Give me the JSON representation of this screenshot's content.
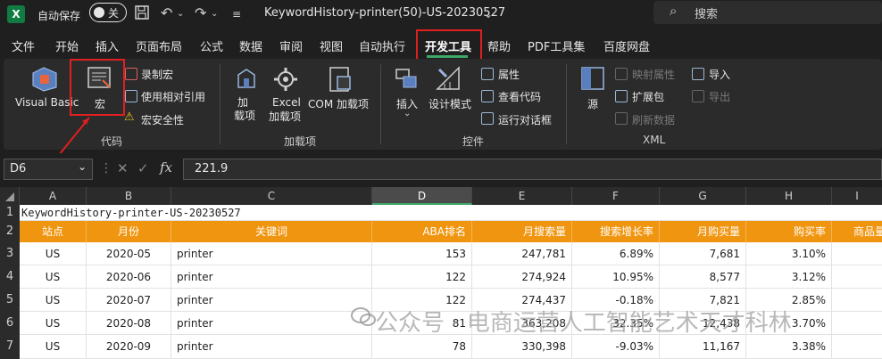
{
  "titlebar": {
    "app_icon": "X",
    "autosave_label": "自动保存",
    "autosave_state": "关",
    "save_icon": "save-icon",
    "doc_title": "KeywordHistory-printer(50)-US-20230527",
    "search_placeholder": "搜索"
  },
  "tabs": [
    "文件",
    "开始",
    "插入",
    "页面布局",
    "公式",
    "数据",
    "审阅",
    "视图",
    "自动执行",
    "开发工具",
    "帮助",
    "PDF工具集",
    "百度网盘"
  ],
  "active_tab": "开发工具",
  "ribbon": {
    "code": {
      "group_label": "代码",
      "visual_basic": "Visual Basic",
      "macro": "宏",
      "record_macro": "录制宏",
      "relative_ref": "使用相对引用",
      "macro_security": "宏安全性"
    },
    "addins": {
      "group_label": "加载项",
      "addins": "加\n载项",
      "excel_addins_1": "Excel",
      "excel_addins_2": "加载项",
      "com_addins": "COM 加载项",
      "addins_1": "加",
      "addins_2": "载项"
    },
    "controls": {
      "group_label": "控件",
      "insert": "插入",
      "design_mode": "设计模式",
      "properties": "属性",
      "view_code": "查看代码",
      "run_dialog": "运行对话框"
    },
    "xml": {
      "group_label": "XML",
      "source": "源",
      "map_props": "映射属性",
      "expansion": "扩展包",
      "refresh": "刷新数据",
      "import": "导入",
      "export": "导出"
    }
  },
  "formula_bar": {
    "name_box": "D6",
    "value": "221.9"
  },
  "columns": [
    "A",
    "B",
    "C",
    "D",
    "E",
    "F",
    "G",
    "H",
    "I"
  ],
  "selected_column": "D",
  "rows": {
    "row1_title": "KeywordHistory-printer-US-20230527",
    "headers": [
      "站点",
      "月份",
      "关键词",
      "ABA排名",
      "月搜索量",
      "搜索增长率",
      "月购买量",
      "购买率",
      "商品量"
    ],
    "data": [
      [
        "US",
        "2020-05",
        "printer",
        "153",
        "247,781",
        "6.89%",
        "7,681",
        "3.10%"
      ],
      [
        "US",
        "2020-06",
        "printer",
        "122",
        "274,924",
        "10.95%",
        "8,577",
        "3.12%"
      ],
      [
        "US",
        "2020-07",
        "printer",
        "122",
        "274,437",
        "-0.18%",
        "7,821",
        "2.85%"
      ],
      [
        "US",
        "2020-08",
        "printer",
        "81",
        "363,208",
        "32.35%",
        "12,438",
        "3.70%"
      ],
      [
        "US",
        "2020-09",
        "printer",
        "78",
        "330,398",
        "-9.03%",
        "11,167",
        "3.38%"
      ]
    ],
    "row_numbers": [
      "1",
      "2",
      "3",
      "4",
      "5",
      "6",
      "7"
    ]
  },
  "watermark": "公众号 · 电商运营人工智能艺术天才科林",
  "colors": {
    "accent_green": "#3fa768",
    "header_orange": "#f0950f",
    "highlight_red": "#e02020"
  }
}
